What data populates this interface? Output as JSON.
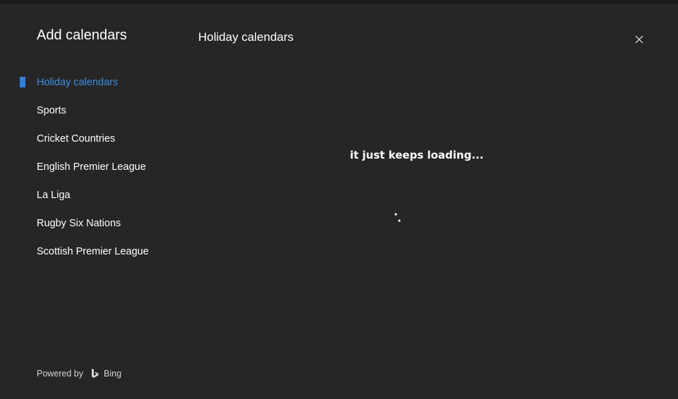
{
  "dialog": {
    "title": "Add calendars",
    "panel_title": "Holiday calendars",
    "close_icon": "close-icon"
  },
  "sidebar": {
    "items": [
      {
        "label": "Holiday calendars",
        "selected": true
      },
      {
        "label": "Sports",
        "selected": false
      },
      {
        "label": "Cricket Countries",
        "selected": false
      },
      {
        "label": "English Premier League",
        "selected": false
      },
      {
        "label": "La Liga",
        "selected": false
      },
      {
        "label": "Rugby Six Nations",
        "selected": false
      },
      {
        "label": "Scottish Premier League",
        "selected": false
      }
    ]
  },
  "main": {
    "annotation": "it just keeps loading...",
    "spinner_icon": "loading-spinner-icon"
  },
  "footer": {
    "powered_by": "Powered by",
    "brand": "Bing",
    "brand_icon": "bing-icon"
  },
  "colors": {
    "background": "#262626",
    "accent": "#2f80df",
    "selected_text": "#3b8fe3",
    "text": "#ffffff"
  }
}
